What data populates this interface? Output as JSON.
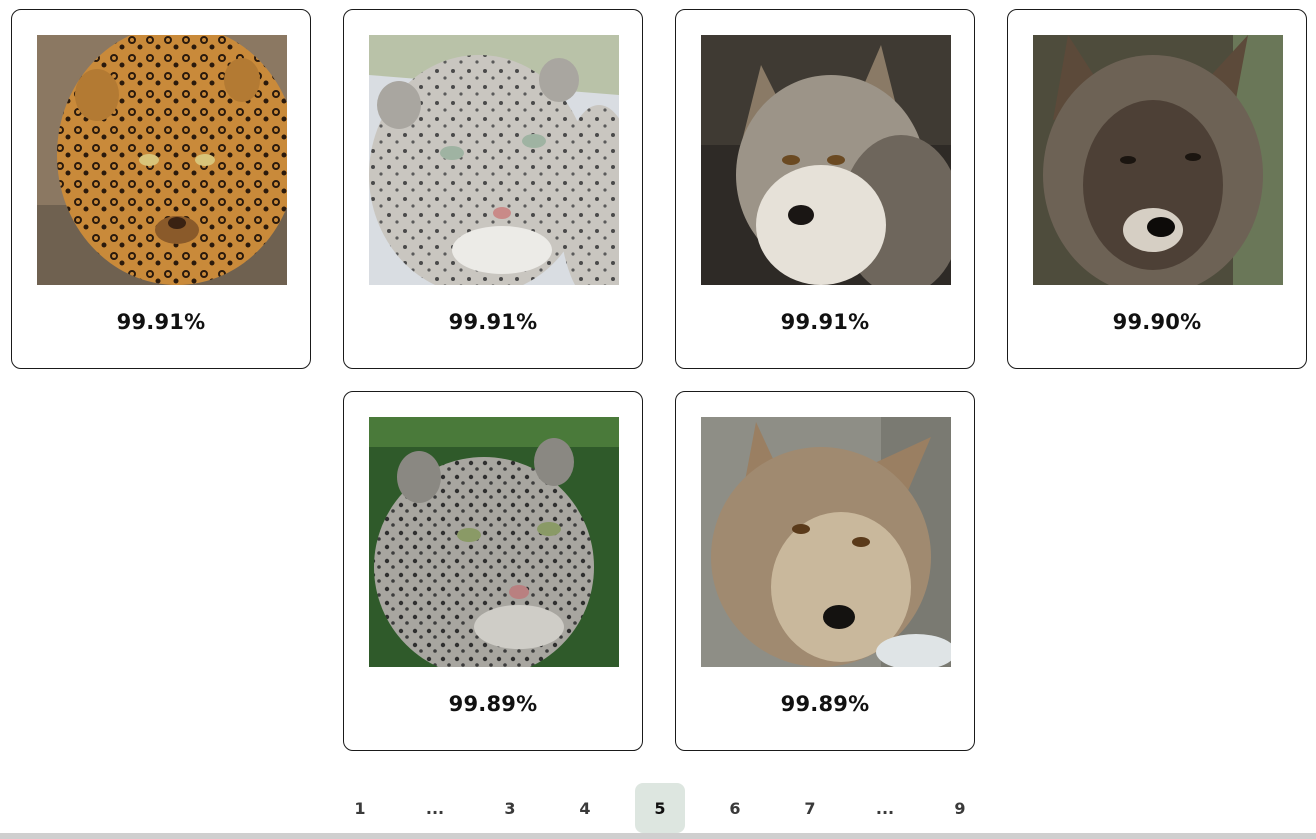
{
  "results": [
    {
      "score": "99.91%",
      "subject": "jaguar"
    },
    {
      "score": "99.91%",
      "subject": "snow-leopard"
    },
    {
      "score": "99.91%",
      "subject": "wolf"
    },
    {
      "score": "99.90%",
      "subject": "wolf"
    },
    {
      "score": "99.89%",
      "subject": "snow-leopard"
    },
    {
      "score": "99.89%",
      "subject": "wolf"
    }
  ],
  "pagination": {
    "items": [
      "1",
      "...",
      "3",
      "4",
      "5",
      "6",
      "7",
      "...",
      "9"
    ],
    "current": "5"
  }
}
